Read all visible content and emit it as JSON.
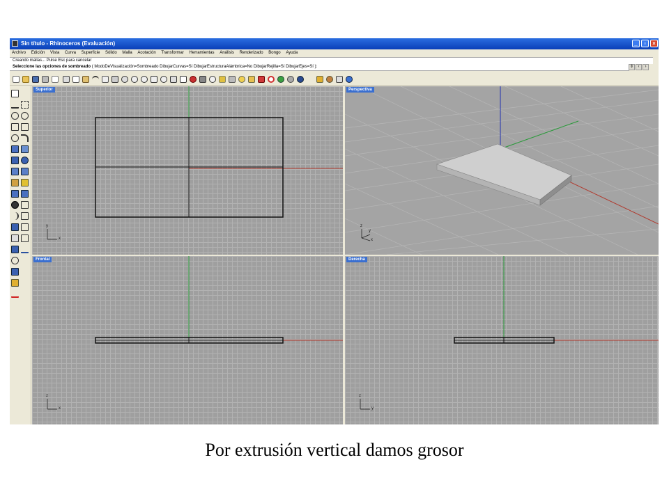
{
  "window": {
    "title": "Sin título - Rhinoceros (Evaluación)",
    "buttons": {
      "minimize": "_",
      "maximize": "▫",
      "close": "×"
    }
  },
  "menu": [
    "Archivo",
    "Edición",
    "Vista",
    "Curva",
    "Superficie",
    "Sólido",
    "Malla",
    "Acotación",
    "Transformar",
    "Herramientas",
    "Análisis",
    "Renderizado",
    "Bongo",
    "Ayuda"
  ],
  "command": {
    "history": "Creando mallas... Pulse Esc para cancelar",
    "prompt": "Seleccione las opciones de sombreado",
    "options": "( ModoDeVisualización=Sombreado  DibujarCurvas=Sí  DibujarEstructuraAlámbrica=No  DibujarRejilla=Sí  DibujarEjes=Sí ):"
  },
  "viewports": {
    "top": {
      "label": "Superior",
      "axis_a": "y",
      "axis_b": "x"
    },
    "perspective": {
      "label": "Perspectiva",
      "axis_a": "z",
      "axis_b": "y",
      "axis_c": "x"
    },
    "front": {
      "label": "Frontal",
      "axis_a": "z",
      "axis_b": "x"
    },
    "right": {
      "label": "Derecha",
      "axis_a": "z",
      "axis_b": "y"
    }
  },
  "colors": {
    "x_axis": "#b03a2e",
    "y_axis": "#2a9a3a",
    "z_axis": "#2030b0",
    "viewport_bg": "#9f9f9f",
    "grid": "#b2b2b2",
    "label_bg": "#3a6fd0"
  },
  "caption": "Por extrusión vertical damos grosor"
}
